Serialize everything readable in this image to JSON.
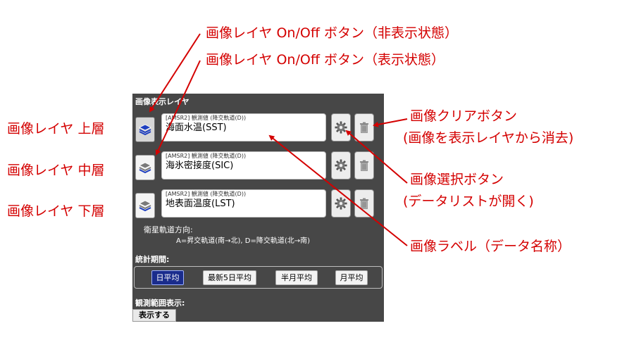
{
  "annotations": {
    "layer_toggle_hidden": "画像レイヤ On/Off ボタン（非表示状態）",
    "layer_toggle_shown": "画像レイヤ On/Off ボタン（表示状態）",
    "layer_top": "画像レイヤ 上層",
    "layer_middle": "画像レイヤ 中層",
    "layer_bottom": "画像レイヤ 下層",
    "clear_button_line1": "画像クリアボタン",
    "clear_button_line2": "(画像を表示レイヤから消去)",
    "select_button_line1": "画像選択ボタン",
    "select_button_line2": "(データリストが開く)",
    "image_label": "画像ラベル（データ名称）"
  },
  "panel": {
    "title": "画像表示レイヤ",
    "layers": [
      {
        "sub": "[AMSR2] 観測値 (降交軌道(D))",
        "main": "海面水温(SST)",
        "state": "shown"
      },
      {
        "sub": "[AMSR2] 観測値 (降交軌道(D))",
        "main": "海氷密接度(SIC)",
        "state": "hidden"
      },
      {
        "sub": "[AMSR2] 観測値 (降交軌道(D))",
        "main": "地表面温度(LST)",
        "state": "hidden"
      }
    ],
    "orbit_title": "衛星軌道方向:",
    "orbit_text": "A=昇交軌道(南→北), D=降交軌道(北→南)",
    "stats_title": "統計期間:",
    "stats_buttons": [
      "日平均",
      "最新5日平均",
      "半月平均",
      "月平均"
    ],
    "stats_active": "日平均",
    "range_title": "観測範囲表示:",
    "range_button": "表示する"
  },
  "icons": {
    "layer_toggle": "layers-icon",
    "select": "gear-icon",
    "clear": "trash-icon"
  },
  "colors": {
    "annotation": "#d40000",
    "panel_bg": "#474747",
    "active_button": "#1a2c8c",
    "layers_icon_blue": "#1f3fbf"
  }
}
